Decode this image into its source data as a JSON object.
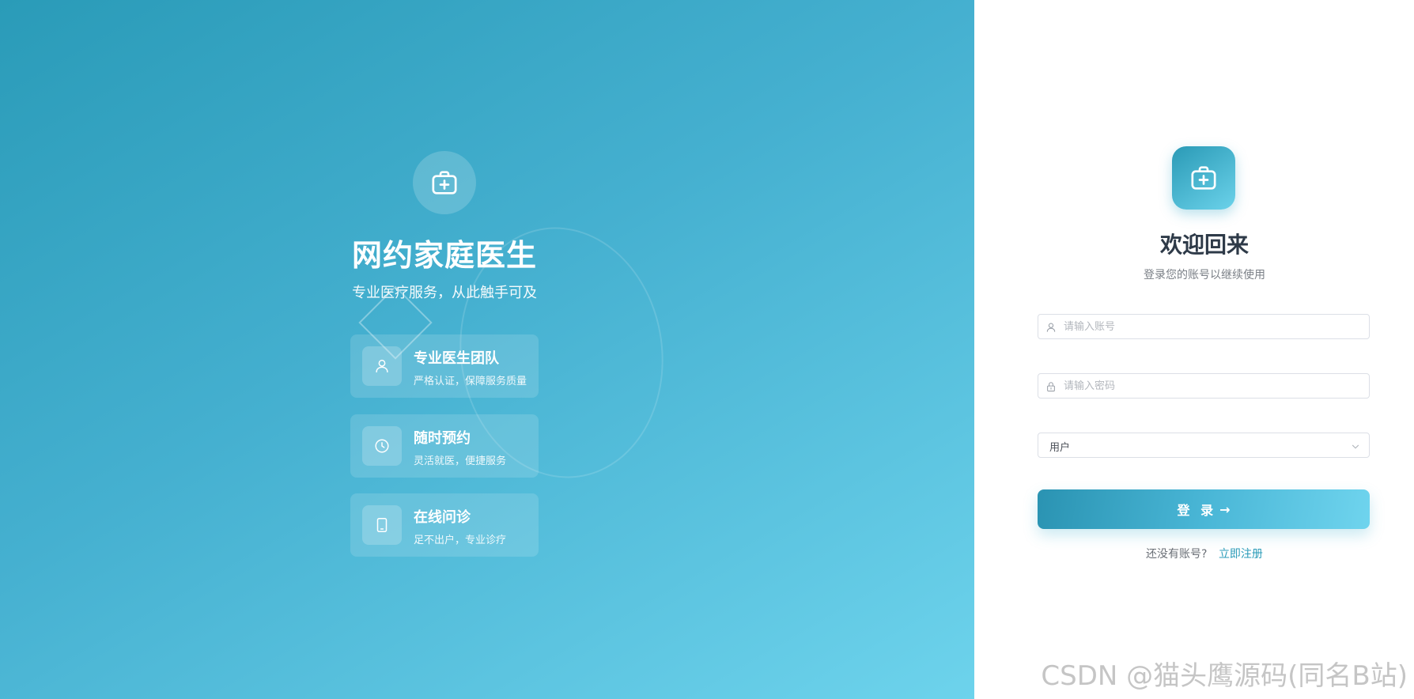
{
  "brand": {
    "title": "网约家庭医生",
    "subtitle": "专业医疗服务，从此触手可及",
    "icon": "medical-kit-icon"
  },
  "features": [
    {
      "title": "专业医生团队",
      "desc": "严格认证，保障服务质量",
      "icon": "user-icon"
    },
    {
      "title": "随时预约",
      "desc": "灵活就医，便捷服务",
      "icon": "clock-icon"
    },
    {
      "title": "在线问诊",
      "desc": "足不出户，专业诊疗",
      "icon": "tablet-icon"
    }
  ],
  "login": {
    "logo_icon": "medical-kit-icon",
    "title": "欢迎回来",
    "subtitle": "登录您的账号以继续使用",
    "username_placeholder": "请输入账号",
    "password_placeholder": "请输入密码",
    "role_value": "用户",
    "submit_label": "登 录",
    "submit_arrow": "→",
    "no_account_text": "还没有账号?",
    "register_link": "立即注册"
  },
  "colors": {
    "accent": "#2a9bb8",
    "accent_light": "#6dd3ec",
    "heading": "#2e3a48"
  },
  "watermark": "CSDN @猫头鹰源码(同名B站)"
}
